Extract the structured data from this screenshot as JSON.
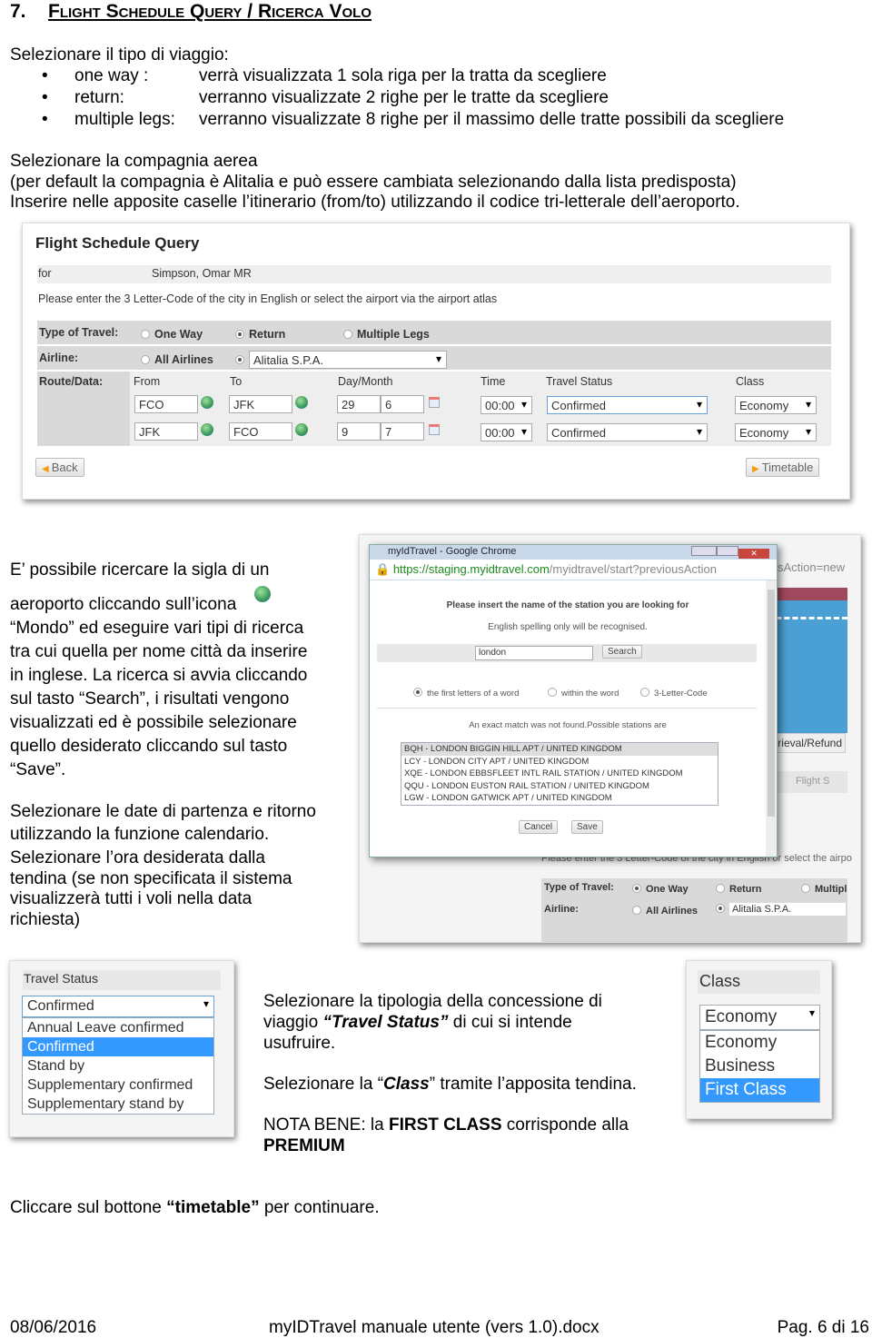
{
  "heading": {
    "number": "7.",
    "title": "Flight Schedule Query / Ricerca Volo"
  },
  "intro": {
    "travel_type_label": "Selezionare il tipo di viaggio:",
    "bullets": [
      {
        "term": "one way :",
        "desc": "verrà visualizzata 1 sola riga per la tratta da scegliere"
      },
      {
        "term": "return:",
        "desc": "verranno visualizzate 2 righe per le tratte da scegliere"
      },
      {
        "term": "multiple legs:",
        "desc": "verranno visualizzate 8 righe per il massimo delle tratte possibili da scegliere"
      }
    ],
    "airline_lines": [
      "Selezionare la compagnia aerea",
      "(per default la compagnia è Alitalia e può essere cambiata selezionando dalla lista predisposta)",
      "Inserire nelle apposite caselle l’itinerario (from/to) utilizzando il codice tri-letterale dell’aeroporto."
    ]
  },
  "fsq": {
    "title": "Flight Schedule Query",
    "for_label": "for",
    "passenger": "Simpson, Omar MR",
    "instruction": "Please enter the 3 Letter-Code of the city in English or select the airport via the airport atlas",
    "type_label": "Type of Travel:",
    "types": [
      "One Way",
      "Return",
      "Multiple Legs"
    ],
    "selected_type": "Return",
    "airline_label": "Airline:",
    "all_airlines": "All Airlines",
    "airline": "Alitalia S.P.A.",
    "route_label": "Route/Data:",
    "columns": [
      "From",
      "To",
      "Day/Month",
      "Time",
      "Travel Status",
      "Class"
    ],
    "legs": [
      {
        "from": "FCO",
        "to": "JFK",
        "day": "29",
        "month": "6",
        "time": "00:00",
        "status": "Confirmed",
        "class": "Economy"
      },
      {
        "from": "JFK",
        "to": "FCO",
        "day": "9",
        "month": "7",
        "time": "00:00",
        "status": "Confirmed",
        "class": "Economy"
      }
    ],
    "back": "Back",
    "timetable": "Timetable"
  },
  "airport_text": {
    "lines": [
      "E’ possibile ricercare la sigla di un",
      "aeroporto cliccando sull’icona",
      "“Mondo” ed  eseguire vari tipi di ricerca",
      "tra cui quella per nome città da inserire",
      "in inglese. La ricerca si avvia cliccando",
      "sul tasto “Search”, i risultati vengono",
      "visualizzati ed è possibile selezionare",
      "quello desiderato cliccando sul tasto",
      "“Save”."
    ],
    "date_lines": [
      "Selezionare le date di partenza e ritorno",
      "utilizzando la funzione calendario.",
      "Selezionare l’ora desiderata dalla",
      "tendina (se non specificata il sistema",
      "visualizzerà tutti i voli nella data",
      "richiesta)"
    ]
  },
  "popup": {
    "window_title": "myIdTravel - Google Chrome",
    "url_host": "https://staging.myidtravel.com",
    "url_path": "/myidtravel/start?previousAction",
    "bg_url_tail": "sAction=new",
    "heading": "Please insert the name of the station you are looking for",
    "subheading": "English spelling only will be recognised.",
    "search_value": "london",
    "search_button": "Search",
    "options": [
      "the first letters of a word",
      "within the word",
      "3-Letter-Code"
    ],
    "selected_option": "the first letters of a word",
    "result_msg": "An exact match was not found.Possible stations are",
    "results": [
      "BQH - LONDON BIGGIN HILL APT / UNITED KINGDOM",
      "LCY - LONDON CITY APT / UNITED KINGDOM",
      "XQE - LONDON EBBSFLEET INTL RAIL STATION / UNITED KINGDOM",
      "QQU - LONDON EUSTON RAIL STATION / UNITED KINGDOM",
      "LGW - LONDON GATWICK APT / UNITED KINGDOM"
    ],
    "cancel": "Cancel",
    "save": "Save",
    "bg_tab": "rieval/Refund",
    "bg_link": "Flight S",
    "bg_instruction": "Please enter the 3 Letter-Code of the city in English or select the airpo",
    "bg_type_label": "Type of Travel:",
    "bg_types": [
      "One Way",
      "Return",
      "Multipl"
    ],
    "bg_airline_label": "Airline:",
    "bg_all_airlines": "All Airlines",
    "bg_airline": "Alitalia S.P.A."
  },
  "status_shot": {
    "label": "Travel Status",
    "selected": "Confirmed",
    "options": [
      "Annual Leave confirmed",
      "Confirmed",
      "Stand by",
      "Supplementary confirmed",
      "Supplementary stand by"
    ],
    "highlighted": "Confirmed"
  },
  "middle_text": {
    "p1a": "Selezionare la tipologia della concessione di",
    "p1b_pre": "viaggio ",
    "p1b_em": "“Travel Status”",
    "p1b_post": " di cui si intende",
    "p1c": "usufruire.",
    "p2_pre": "Selezionare la “",
    "p2_em": "Class",
    "p2_post": "” tramite l’apposita tendina.",
    "p3_pre": "NOTA BENE: la ",
    "p3_b": "FIRST CLASS",
    "p3_post": " corrisponde alla",
    "p3_line2": "PREMIUM"
  },
  "class_shot": {
    "label": "Class",
    "selected": "Economy",
    "options": [
      "Economy",
      "Business",
      "First Class"
    ],
    "highlighted": "First Class"
  },
  "final": {
    "pre": "Cliccare sul bottone ",
    "b": "“timetable”",
    "post": " per continuare."
  },
  "footer": {
    "date": "08/06/2016",
    "doc": "myIDTravel manuale utente (vers 1.0).docx",
    "page": "Pag. 6 di 16"
  }
}
